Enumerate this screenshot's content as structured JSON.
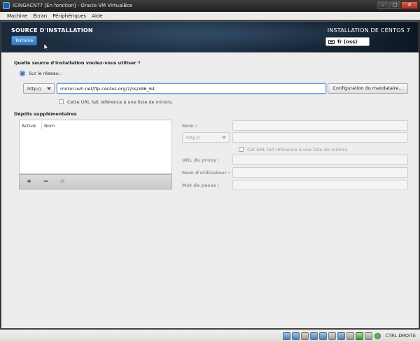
{
  "window": {
    "title": "ICINGACNT7 [En fonction] - Oracle VM VirtualBox",
    "minimize": "–",
    "maximize": "□",
    "close": "✕"
  },
  "menu": [
    "Machine",
    "Écran",
    "Périphériques",
    "Aide"
  ],
  "header": {
    "page_title": "SOURCE D'INSTALLATION",
    "done_label": "Terminé",
    "install_title": "INSTALLATION DE CENTOS 7",
    "keyboard_layout": "fr (oss)"
  },
  "source": {
    "question": "Quelle source d'installation voulez-vous utiliser ?",
    "network_label": "Sur le réseau :",
    "network_selected": true,
    "protocol": "http://",
    "url": "mirror.ovh.net/ftp.centos.org/7/os/x86_64",
    "proxy_button": "Configuration du mandataire...",
    "mirrorlist_label": "Cette URL fait référence à une liste de miroirs.",
    "mirrorlist_checked": false
  },
  "repos": {
    "title": "Dépôts supplémentaires",
    "columns": [
      "Activé",
      "Nom"
    ],
    "add": "+",
    "remove": "−",
    "refresh": "⟳",
    "form": {
      "name_label": "Nom :",
      "protocol": "http://",
      "mirrorlist_label": "Cet URL fait référence à une liste de miroirs.",
      "proxy_url_label": "URL du proxy :",
      "username_label": "Nom d'utilisateur :",
      "password_label": "Mot de passe :"
    }
  },
  "statusbar": {
    "host_key": "CTRL DROITE"
  }
}
